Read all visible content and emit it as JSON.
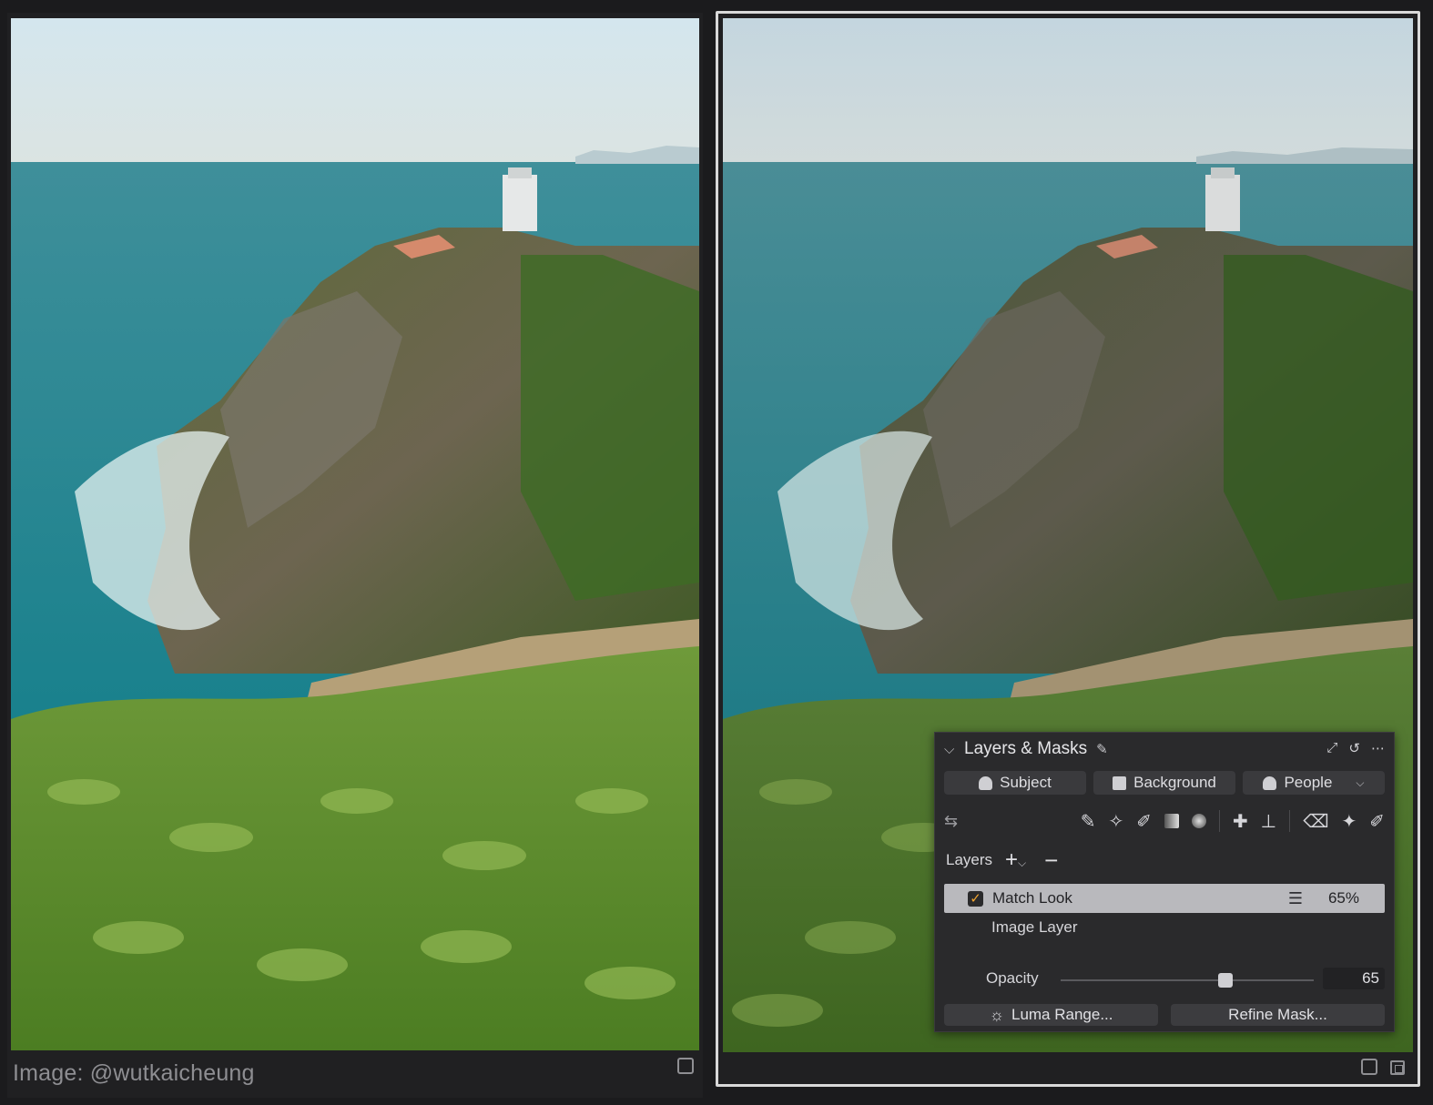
{
  "credit": "Image: @wutkaicheung",
  "panel": {
    "title": "Layers & Masks",
    "mask_buttons": [
      {
        "label": "Subject",
        "icon": "person-icon"
      },
      {
        "label": "Background",
        "icon": "background-icon"
      },
      {
        "label": "People",
        "icon": "people-icon"
      }
    ],
    "layers_label": "Layers",
    "layer": {
      "name": "Match Look",
      "checked": true,
      "opacity_display": "65%"
    },
    "sublayer": "Image Layer",
    "opacity": {
      "label": "Opacity",
      "value": "65",
      "fraction": 0.65
    },
    "luma_label": "Luma Range...",
    "refine_label": "Refine Mask..."
  },
  "colors": {
    "accent_check": "#f0a430",
    "panel_bg": "#2a2a2c",
    "selected_layer_bg": "#b9b9bd"
  }
}
